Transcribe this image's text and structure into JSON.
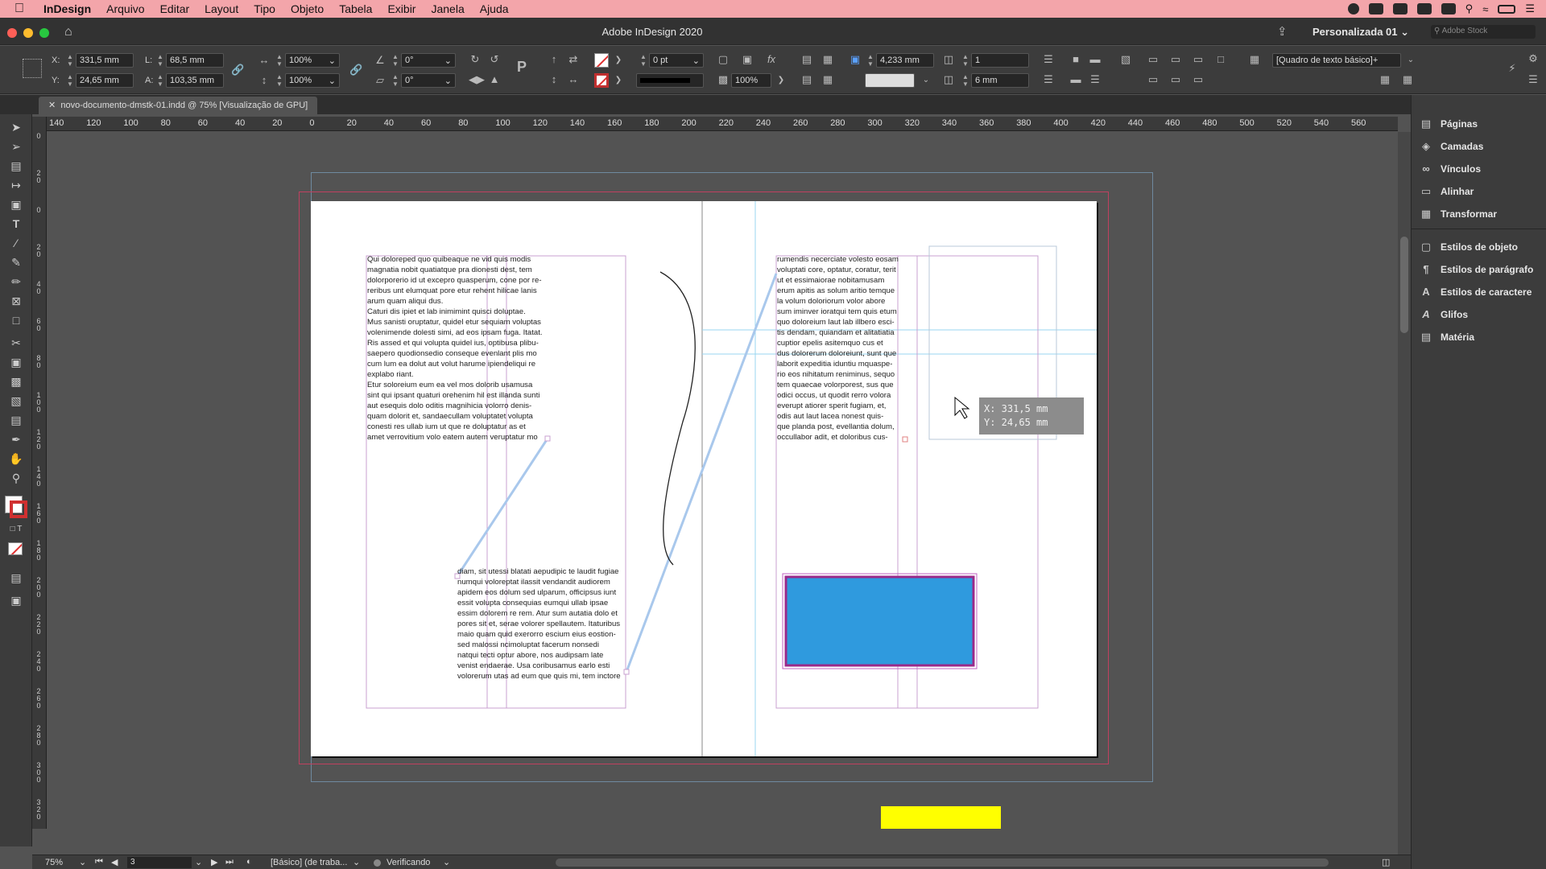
{
  "menubar": {
    "app": "InDesign",
    "items": [
      "Arquivo",
      "Editar",
      "Layout",
      "Tipo",
      "Objeto",
      "Tabela",
      "Exibir",
      "Janela",
      "Ajuda"
    ]
  },
  "titlebar": {
    "title": "Adobe InDesign 2020",
    "workspace": "Personalizada 01",
    "search_placeholder": "Adobe Stock"
  },
  "control": {
    "x_label": "X:",
    "x": "331,5 mm",
    "y_label": "Y:",
    "y": "24,65 mm",
    "w_label": "L:",
    "w": "68,5 mm",
    "h_label": "A:",
    "h": "103,35 mm",
    "scale_x": "100%",
    "scale_y": "100%",
    "angle": "0°",
    "shear": "0°",
    "stroke_weight": "0 pt",
    "opacity": "100%",
    "gutter_value": "4,233 mm",
    "columns": "1",
    "column_gutter": "6 mm",
    "style": "[Quadro de texto básico]+"
  },
  "tab": {
    "label": "novo-documento-dmstk-01.indd @ 75% [Visualização de GPU]"
  },
  "ruler": {
    "h": [
      "140",
      "120",
      "100",
      "80",
      "60",
      "40",
      "20",
      "0",
      "20",
      "40",
      "60",
      "80",
      "100",
      "120",
      "140",
      "160",
      "180",
      "200",
      "220",
      "240",
      "260",
      "280",
      "300",
      "320",
      "340",
      "360",
      "380",
      "400",
      "420",
      "440",
      "460",
      "480",
      "500",
      "520",
      "540",
      "560"
    ],
    "v": [
      "0",
      "2\n0",
      "0",
      "2\n0",
      "4\n0",
      "6\n0",
      "8\n0",
      "1\n0\n0",
      "1\n2\n0",
      "1\n4\n0",
      "1\n6\n0",
      "1\n8\n0",
      "2\n0\n0",
      "2\n2\n0",
      "2\n4\n0",
      "2\n6\n0",
      "2\n8\n0",
      "3\n0\n0",
      "3\n2\n0"
    ]
  },
  "panel": {
    "group1": [
      "Páginas",
      "Camadas",
      "Vínculos",
      "Alinhar",
      "Transformar"
    ],
    "group2": [
      "Estilos de objeto",
      "Estilos de parágrafo",
      "Estilos de caractere",
      "Glifos",
      "Matéria"
    ]
  },
  "frames": {
    "left_top": "Qui doloreped quo quibeaque ne vid quis modis\nmagnatia nobit quatiatque pra dionesti dest, tem\ndolorporerio id ut excepro quasperum, cone por re-\nreribus unt elumquat pore etur rehent hilicae lanis\narum quam aliqui dus.\nCaturi dis ipiet et lab inimimint quisci doluptae.\nMus sanisti oruptatur, quidel etur sequiam voluptas\nvolenimende dolesti simi, ad eos ipsam fuga. Itatat.\nRis assed et qui volupta quidel ius, optibusa plibu-\nsaepero quodionsedio conseque evenlant plis mo\ncum lum ea dolut aut volut harume ipiendeliqui re\nexplabo riant.\nEtur soloreium eum ea vel mos dolorib usamusa\nsint qui ipsant quaturi orehenim hil est illanda sunti\naut esequis dolo oditis magnihicia volorro denis-\nquam dolorit et, sandaecullam voluptatet volupta\nconesti res ullab ium ut que re doluptatur as et\namet verrovitium volo eatem autem veruptatur mo",
    "left_bottom": "diam, sit utessi blatati aepudipic te laudit fugiae\nnumqui voloreptat ilassit vendandit audiorem\napidem eos dolum sed ulparum, officipsus iunt\nessit volupta consequias eumqui ullab ipsae\nessim dolorem re rem. Atur sum autatia dolo et\npores sit et, serae volorer spellautem. Itaturibus\nmaio quam quid exerorro escium eius eostion-\nsed malossi ncimoluptat facerum nonsedi\nnatqui tecti optur abore, nos audipsam late\nvenist endaerae. Usa coribusamus earlo esti\nvolorerum utas ad eum que quis mi, tem inctore",
    "right_top": "rumendis necerciate volesto eosam\nvoluptati core, optatur, coratur, terit\nut et essimaiorae nobitamusam\nerum apitis as solum aritio temque\nla volum doloriorum volor abore\nsum iminver ioratqui tem quis etum\nquo doloreium laut lab illbero esci-\ntis dendam, quiandam et alitatiatia\ncuptior epelis asitemquo cus et\ndus dolorerum doloreiunt, sunt que\nlaborit expeditia iduntiu mquaspe-\nrio eos nihitatum reniminus, sequo\ntem quaecae volorporest, sus que\nodici occus, ut quodit rerro volora\neverupt atiorer sperit fugiam, et,\nodis aut laut lacea nonest quis-\nque planda post, evellantia dolum,\noccullabor adit, et doloribus cus-"
  },
  "tooltip": {
    "x": "X: 331,5 mm",
    "y": "Y: 24,65 mm"
  },
  "status": {
    "zoom": "75%",
    "page": "3",
    "workspace": "[Básico] (de traba...",
    "preflight": "Verificando"
  },
  "colors": {
    "blue_rect": "#2f9ade",
    "yellow_rect": "#ffff00",
    "guide": "#9ad6f0",
    "frame": "#c9a0d0"
  }
}
